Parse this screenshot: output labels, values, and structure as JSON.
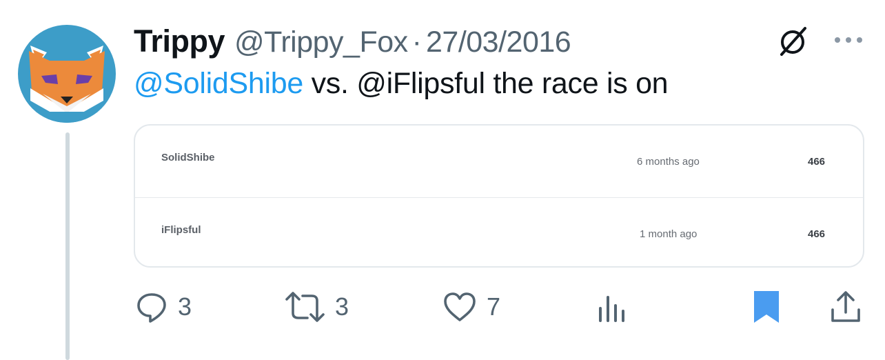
{
  "tweet": {
    "display_name": "Trippy",
    "handle": "@Trippy_Fox",
    "separator": "·",
    "date": "27/03/2016",
    "mention": "@SolidShibe",
    "text": " vs. @iFlipsful the race is on"
  },
  "card": {
    "rows": [
      {
        "name": "SolidShibe",
        "ago": "6 months ago",
        "count": "466"
      },
      {
        "name": "iFlipsful",
        "ago": "1 month ago",
        "count": "466"
      }
    ]
  },
  "actions": {
    "replies": "3",
    "retweets": "3",
    "likes": "7"
  },
  "colors": {
    "accent": "#1d9bf0",
    "bookmark": "#4a9cf0",
    "muted": "#536471"
  },
  "icons": {
    "avatar": "fox-avatar",
    "grok": "slash-circle-icon",
    "more": "ellipsis-icon",
    "reply": "reply-icon",
    "retweet": "retweet-icon",
    "like": "heart-icon",
    "views": "analytics-icon",
    "bookmark": "bookmark-icon",
    "share": "share-icon"
  }
}
